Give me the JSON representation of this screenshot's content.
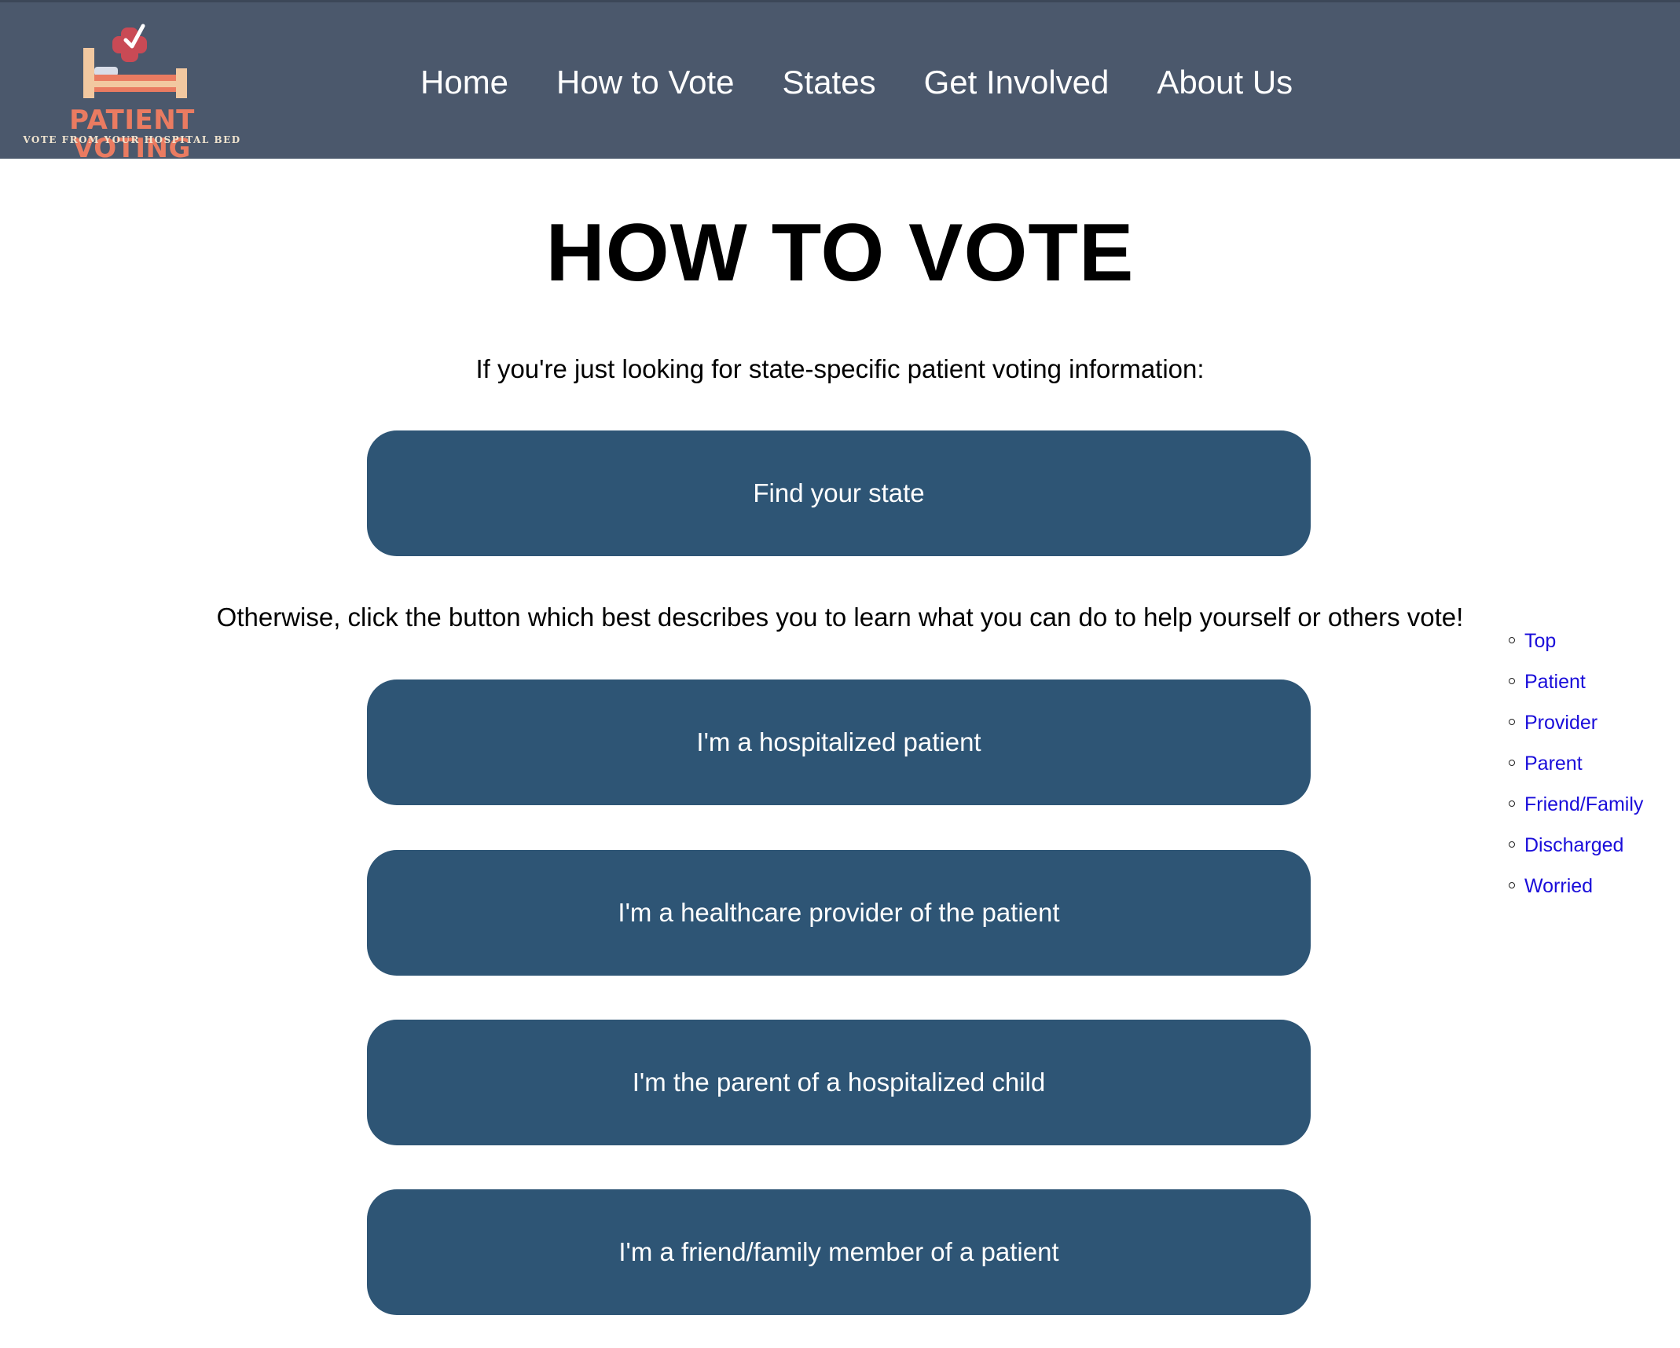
{
  "header": {
    "logo": {
      "title": "PATIENT VOTING",
      "tagline": "VOTE FROM YOUR HOSPITAL BED",
      "colors": {
        "brand": "#ea7b61",
        "cross": "#c94a55",
        "bed_frame": "#f2c8a0"
      }
    },
    "nav": [
      {
        "label": "Home"
      },
      {
        "label": "How to Vote"
      },
      {
        "label": "States"
      },
      {
        "label": "Get Involved"
      },
      {
        "label": "About Us"
      }
    ],
    "background_color": "#4b586c"
  },
  "main": {
    "title": "HOW TO VOTE",
    "intro": "If you're just looking for state-specific patient voting information:",
    "find_state_label": "Find your state",
    "otherwise_text": "Otherwise, click the button which best describes you to learn what you can do to help yourself or others vote!",
    "buttons": [
      {
        "label": "I'm a hospitalized patient"
      },
      {
        "label": "I'm a healthcare provider of the patient"
      },
      {
        "label": "I'm the parent of a hospitalized child"
      },
      {
        "label": "I'm a friend/family member of a patient"
      }
    ],
    "button_color": "#2e5575"
  },
  "toc": {
    "items": [
      {
        "label": "Top"
      },
      {
        "label": "Patient"
      },
      {
        "label": "Provider"
      },
      {
        "label": "Parent"
      },
      {
        "label": "Friend/Family"
      },
      {
        "label": "Discharged"
      },
      {
        "label": "Worried"
      }
    ],
    "link_color": "#1a0dda"
  }
}
